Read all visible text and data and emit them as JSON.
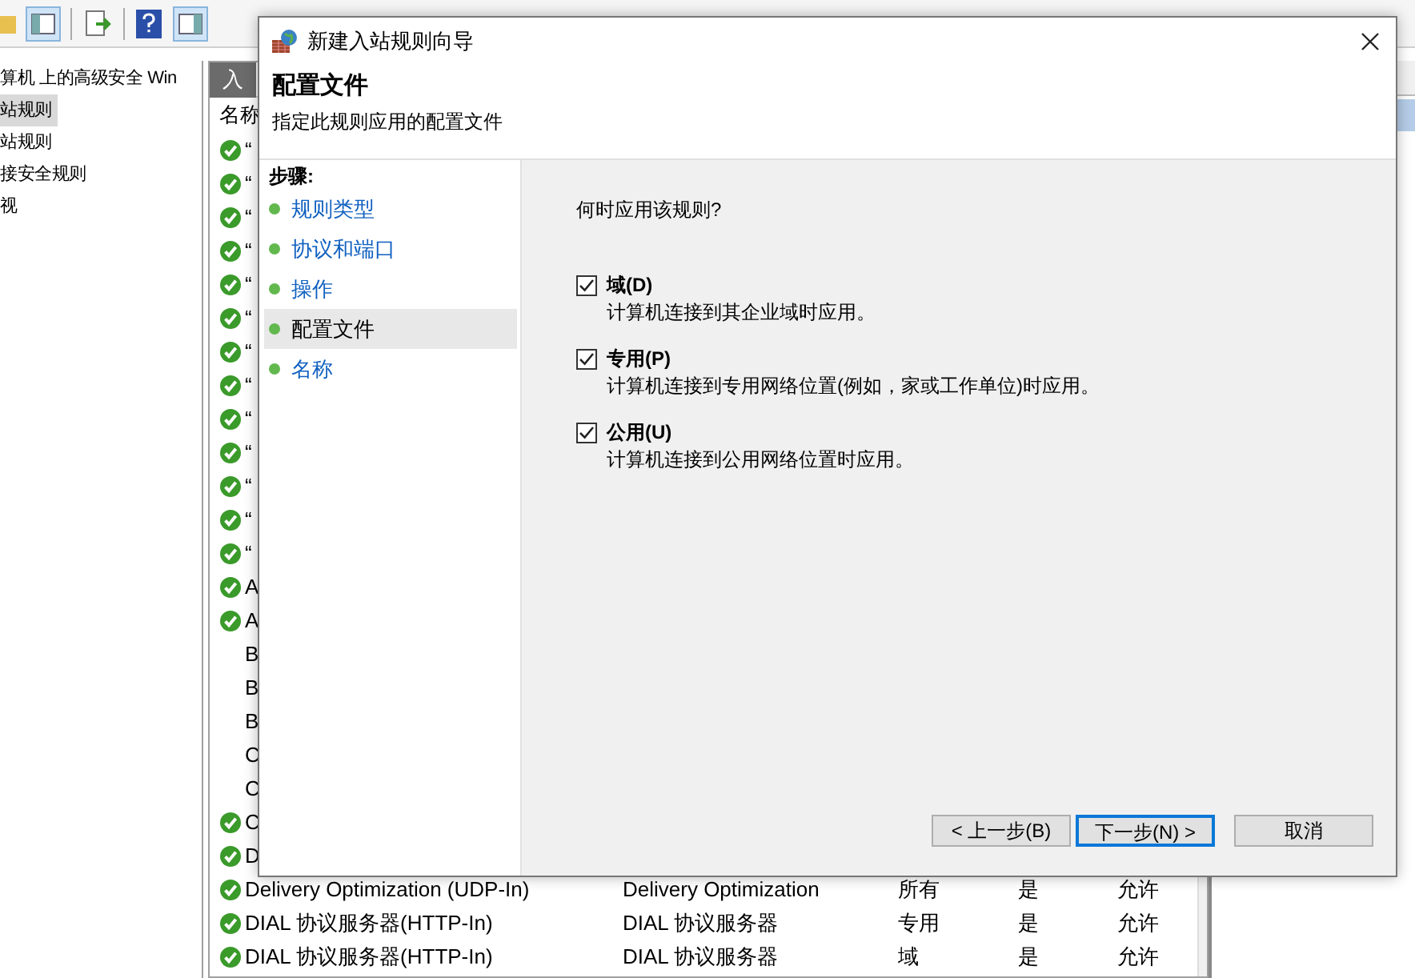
{
  "tree": [
    {
      "label": "算机 上的高级安全 Win",
      "selected": false
    },
    {
      "label": "站规则",
      "selected": true
    },
    {
      "label": "站规则",
      "selected": false
    },
    {
      "label": "接安全规则",
      "selected": false
    },
    {
      "label": "视",
      "selected": false
    }
  ],
  "list": {
    "tab": "入",
    "columns": [
      "名称"
    ],
    "rows": [
      {
        "enabled": true,
        "cells": [
          "“"
        ]
      },
      {
        "enabled": true,
        "cells": [
          "“"
        ]
      },
      {
        "enabled": true,
        "cells": [
          "“"
        ]
      },
      {
        "enabled": true,
        "cells": [
          "“"
        ]
      },
      {
        "enabled": true,
        "cells": [
          "“"
        ]
      },
      {
        "enabled": true,
        "cells": [
          "“"
        ]
      },
      {
        "enabled": true,
        "cells": [
          "“"
        ]
      },
      {
        "enabled": true,
        "cells": [
          "“"
        ]
      },
      {
        "enabled": true,
        "cells": [
          "“"
        ]
      },
      {
        "enabled": true,
        "cells": [
          "“"
        ]
      },
      {
        "enabled": true,
        "cells": [
          "“"
        ]
      },
      {
        "enabled": true,
        "cells": [
          "“"
        ]
      },
      {
        "enabled": true,
        "cells": [
          "“"
        ]
      },
      {
        "enabled": true,
        "cells": [
          "A"
        ]
      },
      {
        "enabled": true,
        "cells": [
          "A"
        ]
      },
      {
        "enabled": false,
        "cells": [
          "B"
        ]
      },
      {
        "enabled": false,
        "cells": [
          "B"
        ]
      },
      {
        "enabled": false,
        "cells": [
          "B"
        ]
      },
      {
        "enabled": false,
        "cells": [
          "C"
        ]
      },
      {
        "enabled": false,
        "cells": [
          "C"
        ]
      },
      {
        "enabled": true,
        "cells": [
          "C"
        ]
      },
      {
        "enabled": true,
        "cells": [
          "D"
        ]
      },
      {
        "enabled": true,
        "cells": [
          "Delivery Optimization (UDP-In)",
          "Delivery Optimization",
          "所有",
          "是",
          "允许"
        ]
      },
      {
        "enabled": true,
        "cells": [
          "DIAL 协议服务器(HTTP-In)",
          "DIAL 协议服务器",
          "专用",
          "是",
          "允许"
        ]
      },
      {
        "enabled": true,
        "cells": [
          "DIAL 协议服务器(HTTP-In)",
          "DIAL 协议服务器",
          "域",
          "是",
          "允许"
        ]
      }
    ]
  },
  "dialog": {
    "title": "新建入站规则向导",
    "heading": "配置文件",
    "subheading": "指定此规则应用的配置文件",
    "steps_label": "步骤:",
    "steps": [
      {
        "label": "规则类型",
        "selected": false
      },
      {
        "label": "协议和端口",
        "selected": false
      },
      {
        "label": "操作",
        "selected": false
      },
      {
        "label": "配置文件",
        "selected": true
      },
      {
        "label": "名称",
        "selected": false
      }
    ],
    "question": "何时应用该规则?",
    "options": [
      {
        "label": "域(D)",
        "description": "计算机连接到其企业域时应用。",
        "checked": true
      },
      {
        "label": "专用(P)",
        "description": "计算机连接到专用网络位置(例如，家或工作单位)时应用。",
        "checked": true
      },
      {
        "label": "公用(U)",
        "description": "计算机连接到公用网络位置时应用。",
        "checked": true
      }
    ],
    "buttons": [
      {
        "label": "< 上一步(B)",
        "default": false
      },
      {
        "label": "下一步(N) >",
        "default": true
      },
      {
        "label": "取消",
        "default": false
      }
    ]
  }
}
